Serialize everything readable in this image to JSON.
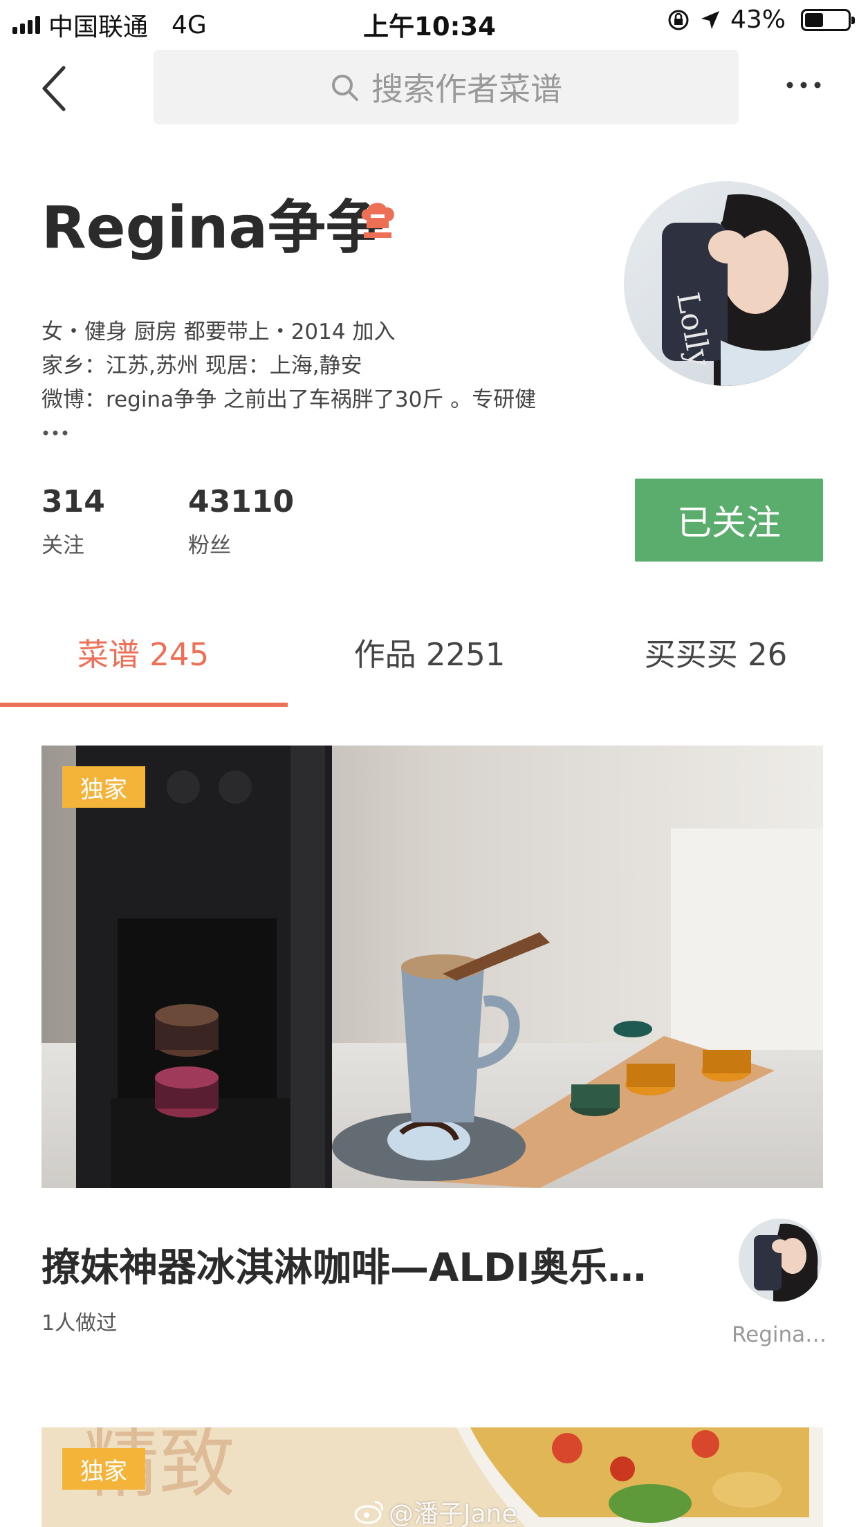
{
  "status_bar": {
    "carrier": "中国联通",
    "network": "4G",
    "time": "上午10:34",
    "battery": "43%",
    "battery_level": 0.43
  },
  "nav": {
    "search_placeholder": "搜索作者菜谱"
  },
  "profile": {
    "name": "Regina争争",
    "bio_lines": [
      "女・健身 厨房 都要带上・2014 加入",
      "家乡：江苏,苏州  现居：上海,静安",
      "微博：regina争争  之前出了车祸胖了30斤 。专研健"
    ],
    "stats": [
      {
        "value": "314",
        "label": "关注"
      },
      {
        "value": "43110",
        "label": "粉丝"
      }
    ],
    "follow_label": "已关注"
  },
  "tabs": [
    {
      "label": "菜谱 245"
    },
    {
      "label": "作品 2251"
    },
    {
      "label": "买买买 26"
    }
  ],
  "recipes": [
    {
      "tag": "独家",
      "title": "撩妹神器冰淇淋咖啡—ALDI奥乐…",
      "cooked": "1人做过",
      "author": "Regina…"
    },
    {
      "tag": "独家"
    }
  ],
  "watermark": "@潘子Jane",
  "colors": {
    "accent": "#ec6f56",
    "follow_green": "#5aad6d",
    "tag_yellow": "#f4b43a"
  }
}
